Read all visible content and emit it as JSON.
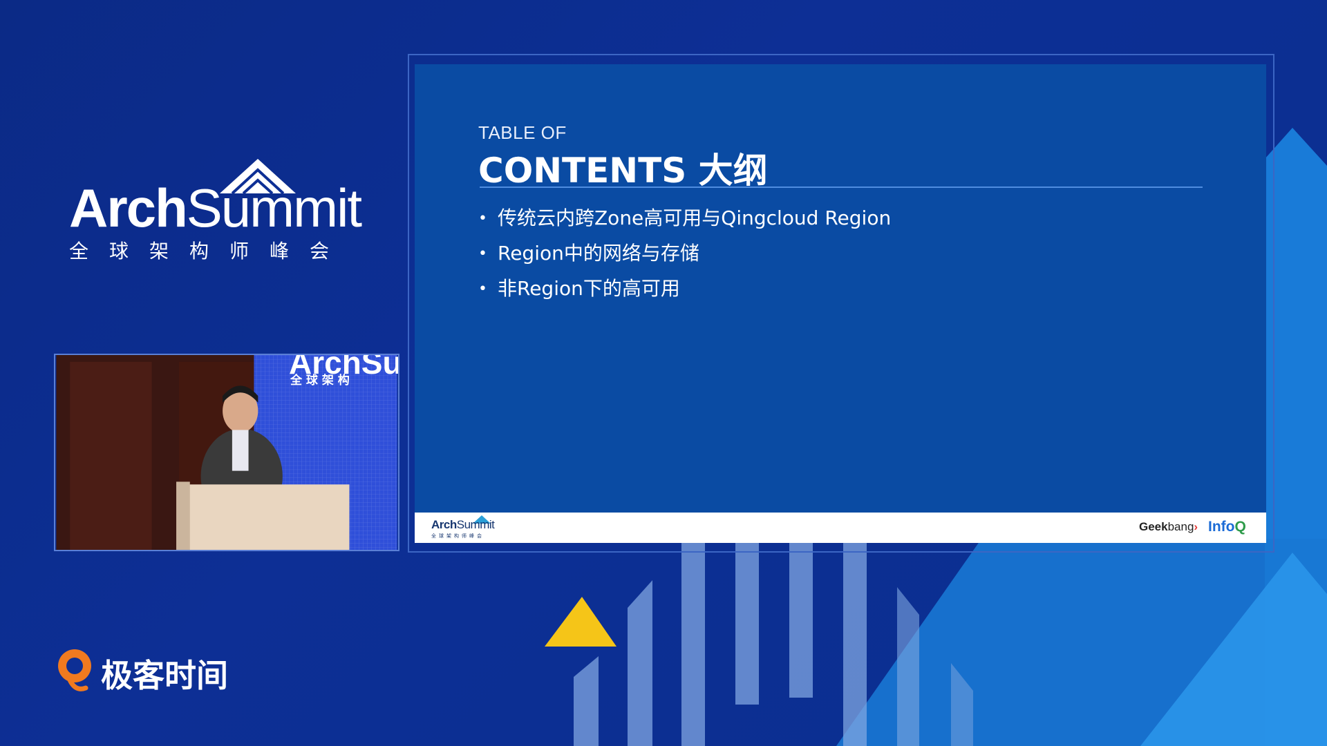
{
  "brand": {
    "title_bold": "Arch",
    "title_light": "Summit",
    "subtitle": "全球架构师峰会"
  },
  "video": {
    "backdrop_text": "ArchSu",
    "backdrop_sub": "全 球 架 构"
  },
  "slide": {
    "kicker": "TABLE OF",
    "title": "CONTENTS 大纲",
    "items": [
      "传统云内跨Zone高可用与Qingcloud Region",
      "Region中的网络与存储",
      "非Region下的高可用"
    ],
    "footer": {
      "left_logo_bold": "Arch",
      "left_logo_light": "Summit",
      "left_logo_sub": "全球架构师峰会",
      "geek_bold": "Geek",
      "geek_light": "bang",
      "geek_mark": "›",
      "infoq": "Info",
      "infoq_q": "Q"
    }
  },
  "geektime": {
    "label": "极客时间"
  },
  "colors": {
    "background": "#0d2f95",
    "slide_bg": "#0a4ba3",
    "accent_blue": "#1e88e5",
    "accent_yellow": "#f5c518"
  }
}
